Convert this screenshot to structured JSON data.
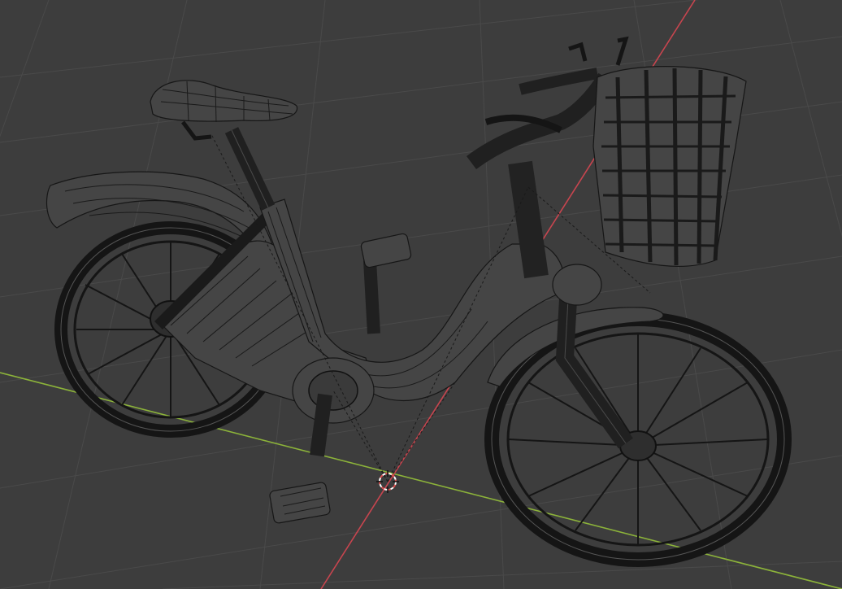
{
  "viewport": {
    "background_color": "#3d3d3d",
    "grid_color": "#4a4a4a",
    "x_axis_color": "#8cb33a",
    "y_axis_color": "#c8454f",
    "wire_color": "#161616",
    "mesh_fill": "#454545",
    "cursor_colors": [
      "#e05050",
      "#ffffff"
    ]
  },
  "scene": {
    "object": "bicycle-mesh",
    "parts": [
      "saddle",
      "seat-post",
      "rear-fender",
      "rear-wheel",
      "frame",
      "chain-guard",
      "crank-pedals",
      "handlebar",
      "front-basket",
      "front-fender",
      "front-wheel",
      "fork"
    ],
    "shading": "wireframe"
  },
  "cursor": {
    "icon": "3d-cursor-icon"
  }
}
